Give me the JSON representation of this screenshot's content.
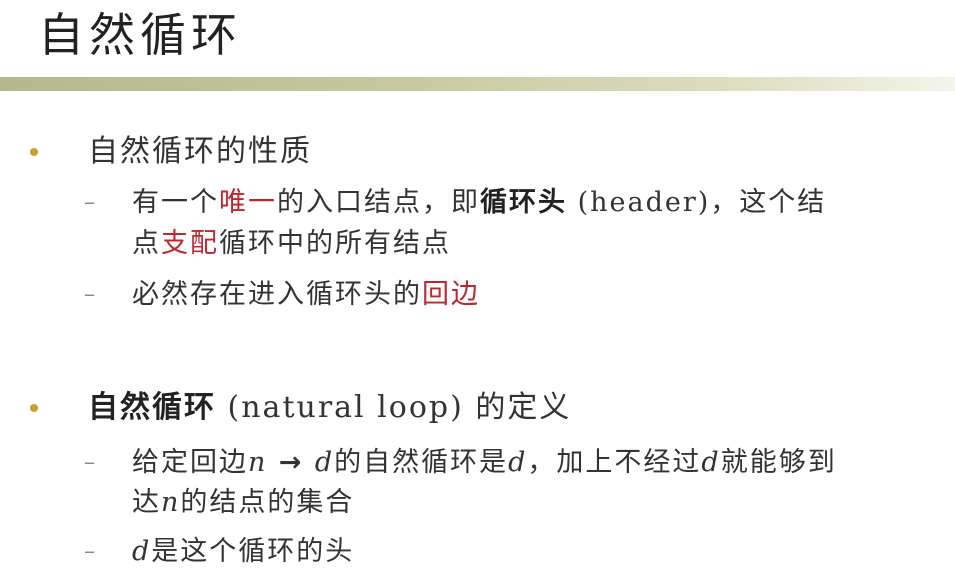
{
  "title": "自然循环",
  "bullets": [
    {
      "text": "自然循环的性质",
      "subitems": [
        {
          "line1_a": "有一个",
          "line1_red": "唯一",
          "line1_b": "的入口结点，即",
          "line1_bold": "循环头",
          "line1_c": " (header)，这个结",
          "line2_a": "点",
          "line2_red": "支配",
          "line2_b": "循环中的所有结点"
        },
        {
          "a": "必然存在进入循环头的",
          "red": "回边"
        }
      ]
    },
    {
      "bold": "自然循环",
      "text": " (natural loop) 的定义",
      "subitems": [
        {
          "a": "给定回边",
          "n": "n",
          "arrow": " → ",
          "d": "d",
          "b": "的自然循环是",
          "d2": "d",
          "c": "，加上不经过",
          "d3": "d",
          "e": "就能够到",
          "line2_a": "达",
          "line2_n": "n",
          "line2_b": "的结点的集合"
        },
        {
          "d": "d",
          "a": "是这个循环的头"
        }
      ]
    }
  ],
  "colors": {
    "accent_red": "#c0262e",
    "bullet": "#c8a030",
    "rule": "#c7c79d"
  }
}
